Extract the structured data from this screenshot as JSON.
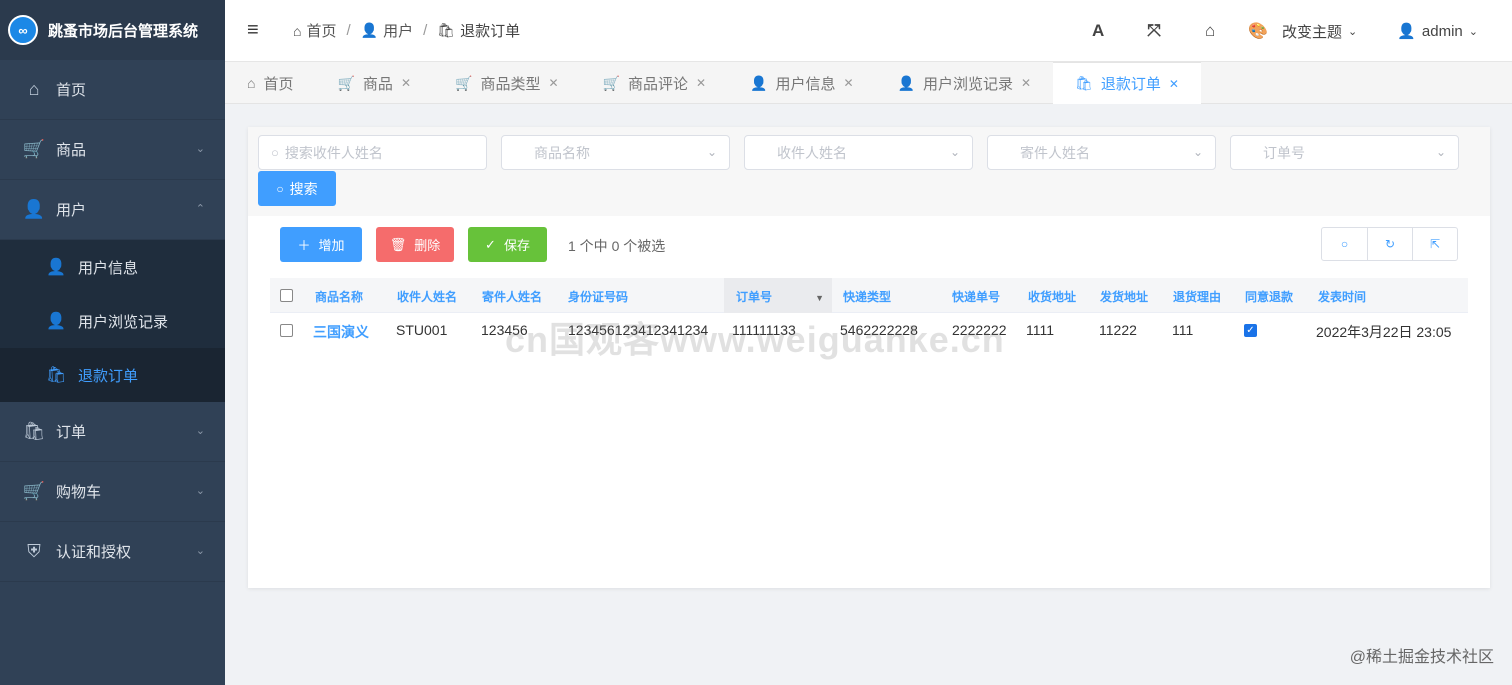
{
  "app": {
    "logo_icon": "infinity-logo",
    "title": "跳蚤市场后台管理系统"
  },
  "sidebar": {
    "items": [
      {
        "label": "首页",
        "icon": "home-icon"
      },
      {
        "label": "商品",
        "icon": "cart-icon"
      },
      {
        "label": "用户",
        "icon": "user-icon"
      },
      {
        "label": "订单",
        "icon": "bag-icon"
      },
      {
        "label": "购物车",
        "icon": "cart-icon"
      },
      {
        "label": "认证和授权",
        "icon": "shield-icon"
      }
    ],
    "submenu": [
      {
        "label": "用户信息",
        "icon": "user-icon"
      },
      {
        "label": "用户浏览记录",
        "icon": "user-icon"
      },
      {
        "label": "退款订单",
        "icon": "bag-icon",
        "active": true
      }
    ]
  },
  "breadcrumb": [
    "首页",
    "用户",
    "退款订单"
  ],
  "navbar": {
    "theme_label": "改变主题",
    "user_label": "admin"
  },
  "tabs": [
    "首页",
    "商品",
    "商品类型",
    "商品评论",
    "用户信息",
    "用户浏览记录",
    "退款订单"
  ],
  "filters": {
    "recipient_search": "搜索收件人姓名",
    "product_name": "商品名称",
    "recipient_name": "收件人姓名",
    "sender_name": "寄件人姓名",
    "order_no": "订单号",
    "search_button": "搜索"
  },
  "toolbar": {
    "add": "增加",
    "delete": "删除",
    "save": "保存",
    "selection": "1 个中 0 个被选"
  },
  "table": {
    "headers": [
      "商品名称",
      "收件人姓名",
      "寄件人姓名",
      "身份证号码",
      "订单号",
      "快递类型",
      "快递单号",
      "收货地址",
      "发货地址",
      "退货理由",
      "同意退款",
      "发表时间"
    ],
    "rows": [
      {
        "product": "三国演义",
        "recipient": "STU001",
        "sender": "123456",
        "id_no": "123456123412341234",
        "order_no": "111111133",
        "courier": "5462222228",
        "tracking": "2222222",
        "recv_addr": "1111",
        "send_addr": "11222",
        "reason": "111",
        "agree": true,
        "time": "2022年3月22日 23:05"
      }
    ]
  },
  "watermark": "cn国观客www.weiguanke.cn",
  "footer_mark": "@稀土掘金技术社区",
  "colors": {
    "primary": "#409eff",
    "danger": "#f56c6c",
    "success": "#67c23a",
    "sidebar": "#304156"
  }
}
